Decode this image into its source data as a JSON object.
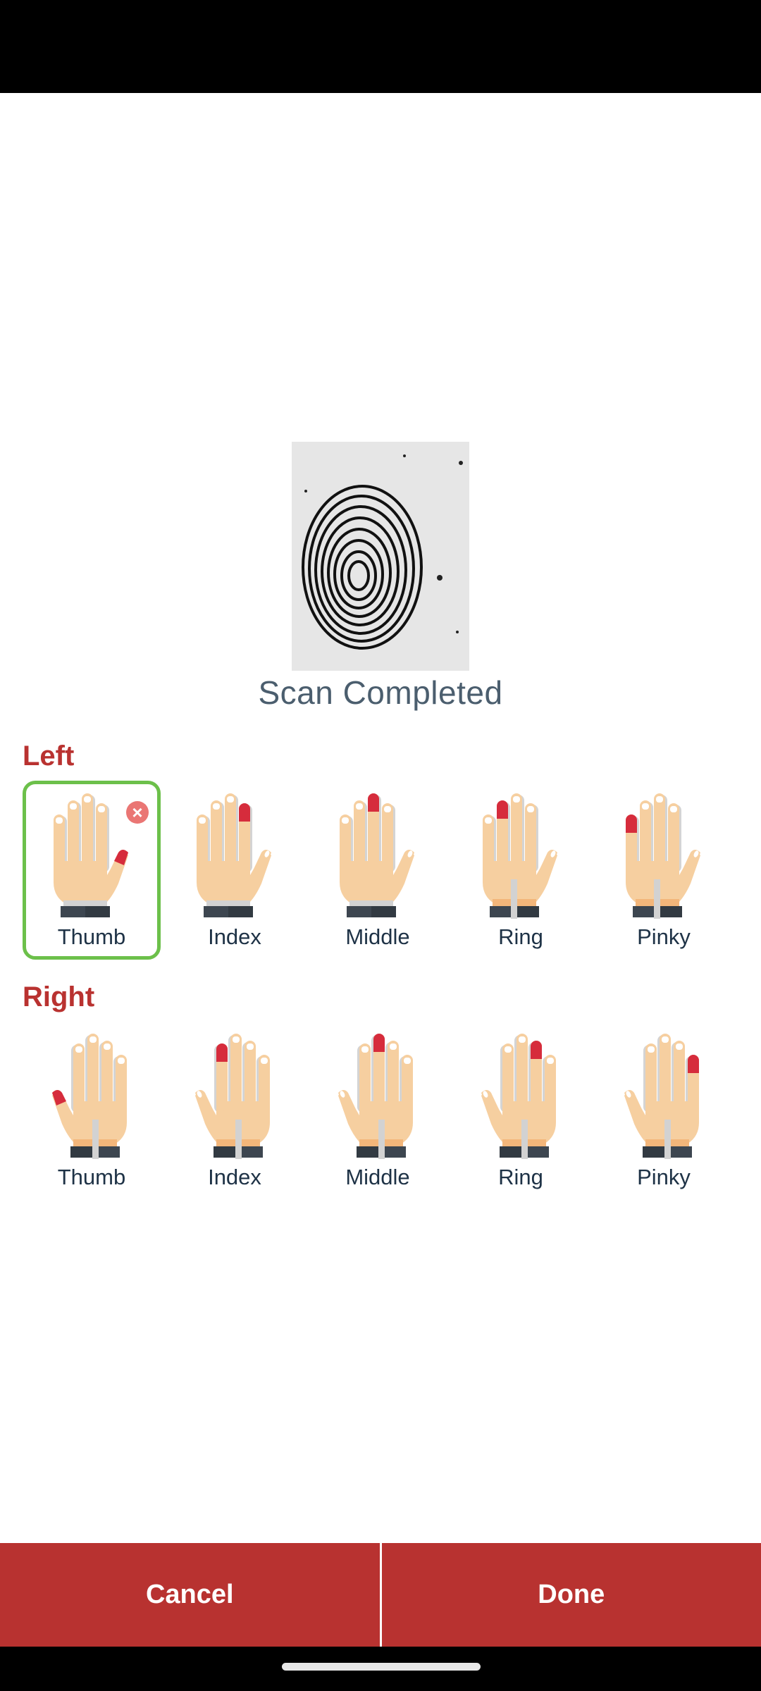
{
  "scan": {
    "status_text": "Scan Completed",
    "image_icon": "fingerprint-image"
  },
  "left_hand": {
    "label": "Left",
    "fingers": [
      {
        "label": "Thumb",
        "highlight": "thumb",
        "selected": true,
        "remove_icon": "×"
      },
      {
        "label": "Index",
        "highlight": "index",
        "selected": false
      },
      {
        "label": "Middle",
        "highlight": "middle",
        "selected": false
      },
      {
        "label": "Ring",
        "highlight": "ring",
        "selected": false
      },
      {
        "label": "Pinky",
        "highlight": "pinky",
        "selected": false
      }
    ]
  },
  "right_hand": {
    "label": "Right",
    "fingers": [
      {
        "label": "Thumb",
        "highlight": "thumb",
        "selected": false
      },
      {
        "label": "Index",
        "highlight": "index",
        "selected": false
      },
      {
        "label": "Middle",
        "highlight": "middle",
        "selected": false
      },
      {
        "label": "Ring",
        "highlight": "ring",
        "selected": false
      },
      {
        "label": "Pinky",
        "highlight": "pinky",
        "selected": false
      }
    ]
  },
  "actions": {
    "cancel_label": "Cancel",
    "done_label": "Done"
  },
  "colors": {
    "accent": "#b83230",
    "section_label": "#b93230",
    "selected_border": "#6cc04a",
    "highlight_finger": "#d62c3c",
    "skin": "#f6cfa0",
    "remove_badge": "#ea7674",
    "status_text": "#4b5e6e",
    "finger_label": "#1e3246"
  }
}
